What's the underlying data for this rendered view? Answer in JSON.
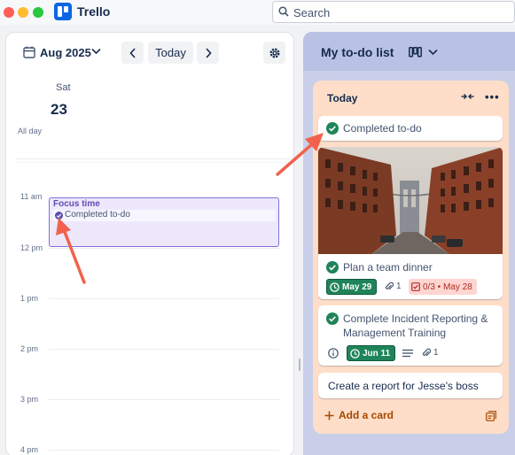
{
  "app": {
    "name": "Trello"
  },
  "search": {
    "placeholder": "Search"
  },
  "calendar": {
    "month_label": "Aug 2025",
    "today_label": "Today",
    "day_name": "Sat",
    "day_number": "23",
    "all_day_label": "All day",
    "hours": [
      "11 am",
      "12 pm",
      "1 pm",
      "2 pm",
      "3 pm",
      "4 pm"
    ],
    "event": {
      "title": "Focus time",
      "todo_label": "Completed to-do"
    }
  },
  "board": {
    "title": "My to-do list",
    "list": {
      "title": "Today",
      "cards": [
        {
          "title": "Completed to-do"
        },
        {
          "title": "Plan a team dinner",
          "due": "May 29",
          "attachments": "1",
          "checklist": "0/3 • May 28"
        },
        {
          "title": "Complete Incident Reporting & Management Training",
          "due": "Jun 11",
          "attachments": "1"
        },
        {
          "title": "Create a report for Jesse's boss"
        }
      ],
      "add_card_label": "Add a card"
    }
  },
  "colors": {
    "accent": "#0c66e4",
    "list_bg": "#fedec8",
    "complete_green": "#1f845a",
    "event_purple": "#8270db",
    "arrow_red": "#f0624d"
  }
}
